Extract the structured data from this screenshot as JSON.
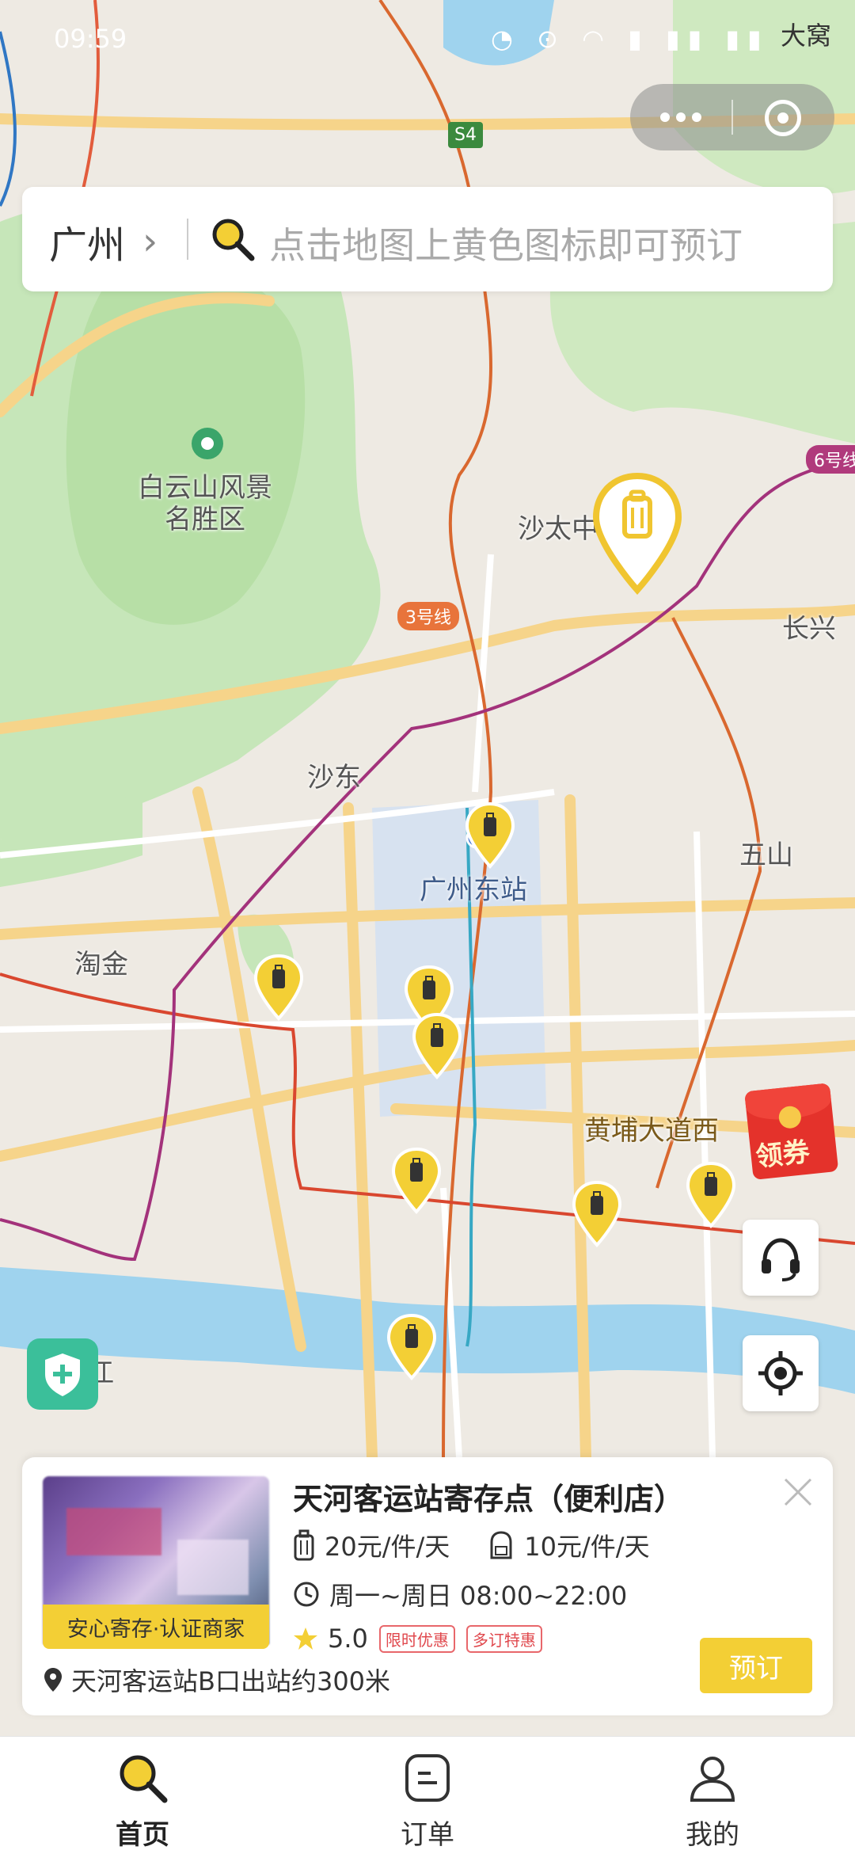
{
  "status_bar": {
    "time": "09:59",
    "network_label": "大窝"
  },
  "search": {
    "city": "广州",
    "placeholder": "点击地图上黄色图标即可预订"
  },
  "map": {
    "labels": {
      "baiyunshan": "白云山风景\n名胜区",
      "shatai": "沙太中",
      "changxing": "长兴",
      "shadong": "沙东",
      "guangzhou_east": "广州东站",
      "wushan": "五山",
      "taojin": "淘金",
      "huangpu": "黄埔大道西",
      "jiang": "江"
    },
    "metro_line3": "3号线",
    "metro_line6": "6号线",
    "road_s4": "S4"
  },
  "coupon": {
    "label": "领券"
  },
  "store": {
    "name": "天河客运站寄存点（便利店）",
    "badge": "安心寄存·认证商家",
    "price_luggage": "20元/件/天",
    "price_bag": "10元/件/天",
    "hours": "周一~周日 08:00~22:00",
    "rating": "5.0",
    "tag1": "限时优惠",
    "tag2": "多订特惠",
    "address": "天河客运站B口出站约300米",
    "book_label": "预订"
  },
  "nav": {
    "home": "首页",
    "orders": "订单",
    "mine": "我的"
  },
  "colors": {
    "accent_yellow": "#f3cf35",
    "shield_green": "#3bbf9a",
    "coupon_red": "#e4322b"
  }
}
